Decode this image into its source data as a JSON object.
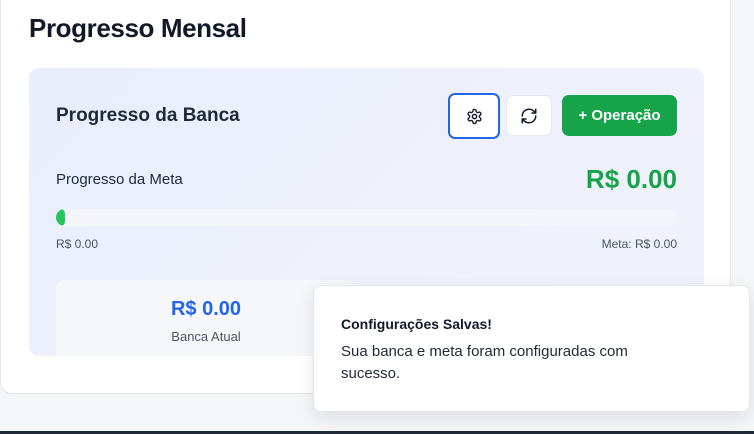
{
  "section": {
    "title": "Progresso Mensal"
  },
  "panel": {
    "title": "Progresso da Banca",
    "settings_icon": "gear-icon",
    "refresh_icon": "refresh-icon",
    "add_button_label": "+ Operação"
  },
  "goal": {
    "label": "Progresso da Meta",
    "value": "R$ 0.00",
    "progress_fraction": 0,
    "range_start": "R$ 0.00",
    "range_end": "Meta: R$ 0.00"
  },
  "stats": [
    {
      "value": "R$ 0.00",
      "label": "Banca Atual"
    }
  ],
  "toast": {
    "title": "Configurações Salvas!",
    "message": "Sua banca e meta foram configuradas com sucesso."
  },
  "colors": {
    "accent_green": "#16a34a",
    "progress_green": "#22c55e",
    "accent_blue": "#2563eb",
    "focus_ring": "#2563eb"
  }
}
